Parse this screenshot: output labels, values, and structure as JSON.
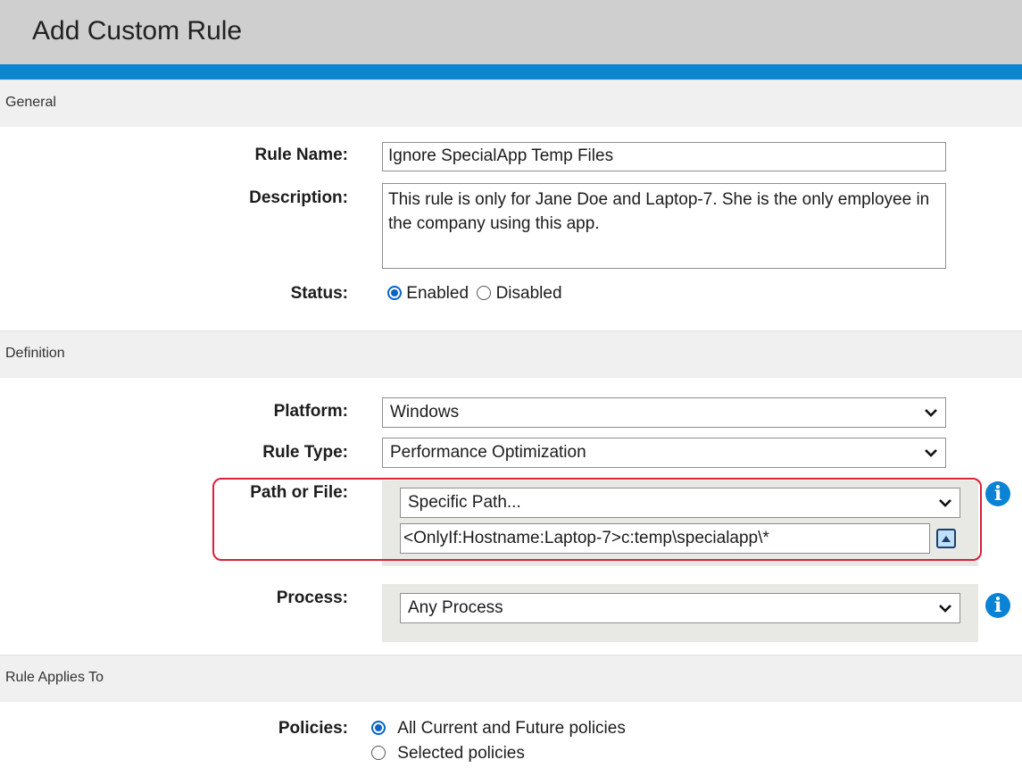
{
  "header": {
    "title": "Add Custom Rule"
  },
  "sections": {
    "general": "General",
    "definition": "Definition",
    "applies_to": "Rule Applies To"
  },
  "general": {
    "rule_name_label": "Rule Name:",
    "rule_name_value": "Ignore SpecialApp Temp Files",
    "description_label": "Description:",
    "description_value": "This rule is only for Jane Doe and Laptop-7. She is the only employee in the company using this app.",
    "status_label": "Status:",
    "status_options": [
      "Enabled",
      "Disabled"
    ],
    "status_selected": "Enabled"
  },
  "definition": {
    "platform_label": "Platform:",
    "platform_value": "Windows",
    "rule_type_label": "Rule Type:",
    "rule_type_value": "Performance Optimization",
    "path_label": "Path or File:",
    "path_select_value": "Specific Path...",
    "path_input_value": "<OnlyIf:Hostname:Laptop-7>c:temp\\specialapp\\*",
    "process_label": "Process:",
    "process_value": "Any Process"
  },
  "applies_to": {
    "policies_label": "Policies:",
    "policy_options": [
      "All Current and Future policies",
      "Selected policies"
    ],
    "policy_selected": "All Current and Future policies"
  },
  "icons": {
    "info": "info-icon",
    "expand": "expand-up-icon",
    "chevron": "chevron-down-icon"
  },
  "colors": {
    "accent": "#0c86d1",
    "highlight": "#d8213a",
    "radio": "#0a63c7"
  }
}
